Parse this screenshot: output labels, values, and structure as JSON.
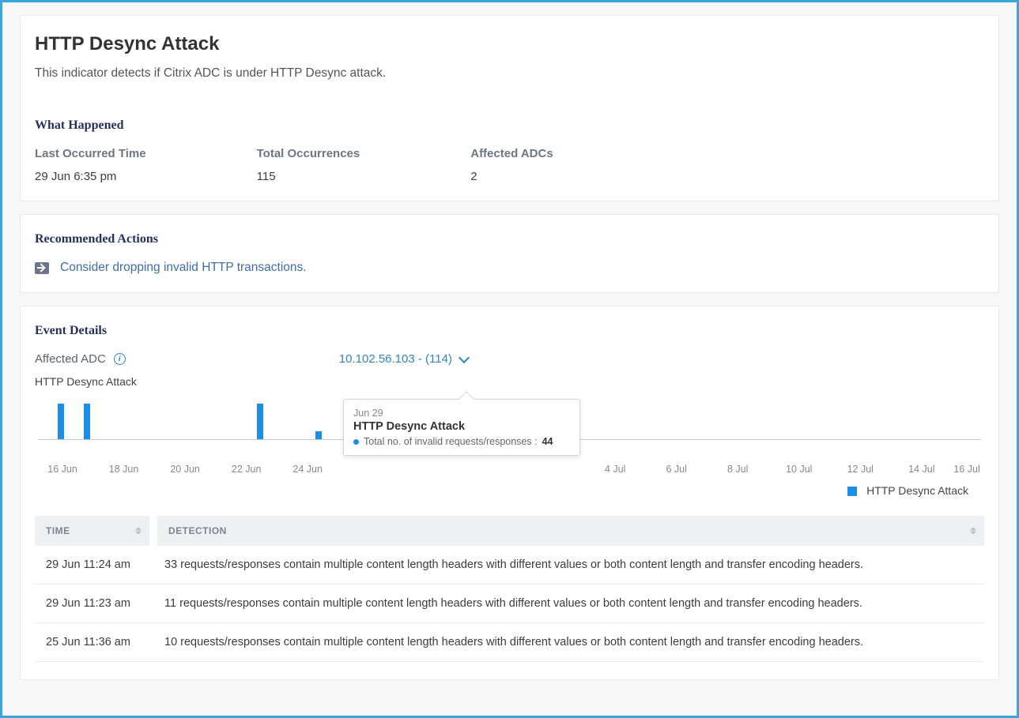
{
  "header": {
    "title": "HTTP Desync Attack",
    "description": "This indicator detects if Citrix ADC is under HTTP Desync attack."
  },
  "what_happened": {
    "heading": "What Happened",
    "labels": {
      "last_occurred": "Last Occurred Time",
      "total": "Total Occurrences",
      "affected": "Affected ADCs"
    },
    "values": {
      "last_occurred": "29 Jun 6:35 pm",
      "total": "115",
      "affected": "2"
    }
  },
  "recommended": {
    "heading": "Recommended Actions",
    "items": [
      "Consider dropping invalid HTTP transactions."
    ]
  },
  "event_details": {
    "heading": "Event Details",
    "affected_label": "Affected ADC",
    "dropdown_value": "10.102.56.103 - (114)",
    "chart_title": "HTTP Desync Attack",
    "legend_label": "HTTP Desync Attack",
    "tooltip": {
      "date": "Jun 29",
      "title": "HTTP Desync Attack",
      "metric_label": "Total no. of invalid requests/responses :",
      "value": "44"
    },
    "table": {
      "columns": {
        "time": "TIME",
        "detection": "DETECTION"
      },
      "rows": [
        {
          "time": "29 Jun 11:24 am",
          "detection": "33 requests/responses contain multiple content length headers with different values or both content length and transfer encoding headers."
        },
        {
          "time": "29 Jun 11:23 am",
          "detection": "11 requests/responses contain multiple content length headers with different values or both content length and transfer encoding headers."
        },
        {
          "time": "25 Jun 11:36 am",
          "detection": "10 requests/responses contain multiple content length headers with different values or both content length and transfer encoding headers."
        }
      ]
    }
  },
  "chart_data": {
    "type": "bar",
    "title": "HTTP Desync Attack",
    "xlabel": "",
    "ylabel": "",
    "x_ticks": [
      "16 Jun",
      "18 Jun",
      "20 Jun",
      "22 Jun",
      "24 Jun",
      "4 Jul",
      "6 Jul",
      "8 Jul",
      "10 Jul",
      "12 Jul",
      "14 Jul",
      "16 Jul"
    ],
    "series": [
      {
        "name": "HTTP Desync Attack",
        "points": [
          {
            "x": "16 Jun",
            "value": 45
          },
          {
            "x": "17 Jun",
            "value": 45
          },
          {
            "x": "23 Jun",
            "value": 45
          },
          {
            "x": "25 Jun",
            "value": 10
          },
          {
            "x": "29 Jun",
            "value": 44
          }
        ]
      }
    ],
    "legend": [
      "HTTP Desync Attack"
    ]
  }
}
